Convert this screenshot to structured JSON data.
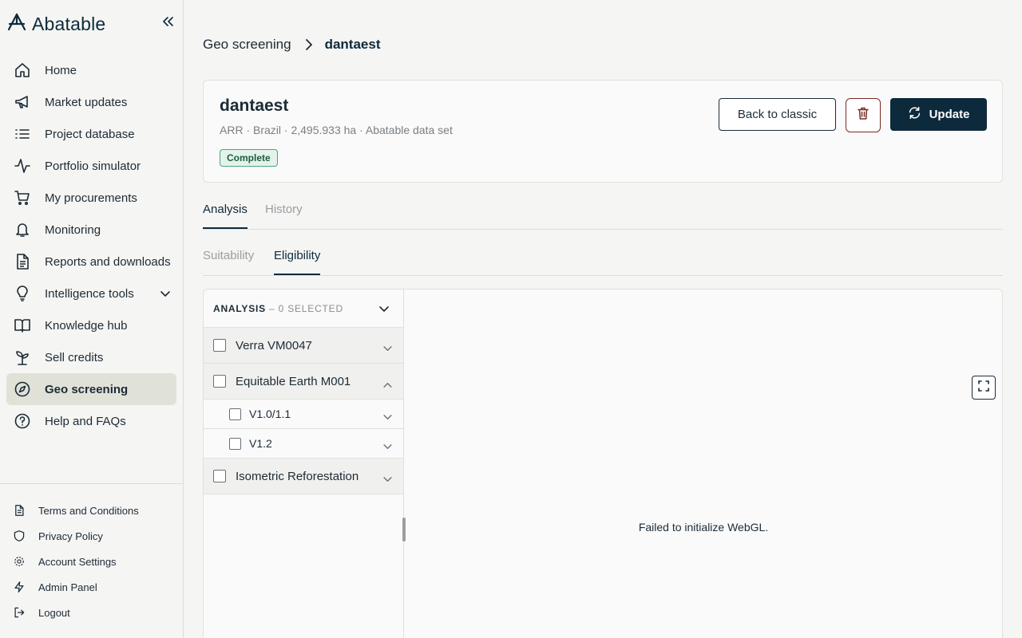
{
  "app": {
    "brand": "Abatable"
  },
  "sidebar": {
    "items": [
      {
        "label": "Home",
        "icon": "home-icon"
      },
      {
        "label": "Market updates",
        "icon": "megaphone-icon"
      },
      {
        "label": "Project database",
        "icon": "list-icon"
      },
      {
        "label": "Portfolio simulator",
        "icon": "activity-icon"
      },
      {
        "label": "My procurements",
        "icon": "cart-icon"
      },
      {
        "label": "Monitoring",
        "icon": "bell-icon"
      },
      {
        "label": "Reports and downloads",
        "icon": "document-icon"
      },
      {
        "label": "Intelligence tools",
        "icon": "lightbulb-icon"
      },
      {
        "label": "Knowledge hub",
        "icon": "book-icon"
      },
      {
        "label": "Sell credits",
        "icon": "sprout-icon"
      },
      {
        "label": "Geo screening",
        "icon": "compass-icon"
      },
      {
        "label": "Help and FAQs",
        "icon": "help-icon"
      }
    ],
    "footer": [
      {
        "label": "Terms and Conditions",
        "icon": "document-icon"
      },
      {
        "label": "Privacy Policy",
        "icon": "shield-icon"
      },
      {
        "label": "Account Settings",
        "icon": "gear-icon"
      },
      {
        "label": "Admin Panel",
        "icon": "bolt-icon"
      },
      {
        "label": "Logout",
        "icon": "logout-icon"
      }
    ]
  },
  "breadcrumb": {
    "parent": "Geo screening",
    "current": "dantaest"
  },
  "project": {
    "title": "dantaest",
    "meta": "ARR · Brazil · 2,495.933 ha · Abatable data set",
    "status": "Complete",
    "back_label": "Back to classic",
    "update_label": "Update"
  },
  "tabs": [
    {
      "label": "Analysis"
    },
    {
      "label": "History"
    }
  ],
  "subtabs": [
    {
      "label": "Suitability"
    },
    {
      "label": "Eligibility"
    }
  ],
  "analysis": {
    "header_title": "ANALYSIS",
    "header_selected": "– 0 SELECTED",
    "rows": [
      {
        "label": "Verra VM0047"
      },
      {
        "label": "Equitable Earth M001"
      },
      {
        "label": "V1.0/1.1"
      },
      {
        "label": "V1.2"
      },
      {
        "label": "Isometric Reforestation"
      }
    ]
  },
  "map": {
    "message": "Failed to initialize WebGL."
  },
  "colors": {
    "primary": "#0d2a3c",
    "active_nav": "#e0e2d8",
    "status_green": "#4ea57a",
    "danger": "#7a2a22"
  }
}
